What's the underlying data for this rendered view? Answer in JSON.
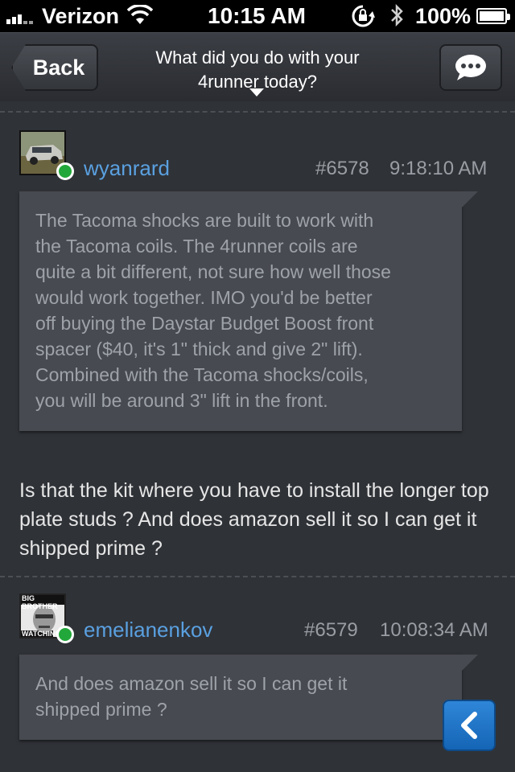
{
  "status_bar": {
    "carrier": "Verizon",
    "time": "10:15 AM",
    "battery": "100%",
    "icons": [
      "signal-icon",
      "wifi-icon",
      "rotation-lock-icon",
      "bluetooth-icon",
      "battery-icon"
    ]
  },
  "nav": {
    "back_label": "Back",
    "title_line1": "What did you do with your",
    "title_line2": "4runner today?",
    "chat_icon": "chat-bubble-icon"
  },
  "posts": [
    {
      "username": "wyanrard",
      "post_number": "#6578",
      "time": "9:18:10 AM",
      "quote": "The Tacoma shocks are built to work with\nthe Tacoma coils. The 4runner coils are\nquite a bit different, not sure how well those\nwould work together. IMO you'd be better\noff buying the Daystar Budget Boost front\nspacer ($40, it's 1\" thick and give 2\" lift).\nCombined with the Tacoma shocks/coils,\nyou will be around 3\" lift in the front."
    },
    {
      "username": "emelianenkov",
      "post_number": "#6579",
      "time": "10:08:34 AM",
      "avatar_text_top": "BIG BROTHER",
      "avatar_text_bottom": "WATCHING",
      "quote": "And does amazon sell it so I can get it\nshipped prime ?"
    }
  ],
  "reply_message": "Is that the kit where you have to install the longer top plate studs ? And does amazon sell it so I can get it shipped prime ?",
  "colors": {
    "background": "#2f3237",
    "username": "#5aa0e0",
    "bubble": "#474a50",
    "online": "#22a83a",
    "fab": "#1f78d1"
  }
}
